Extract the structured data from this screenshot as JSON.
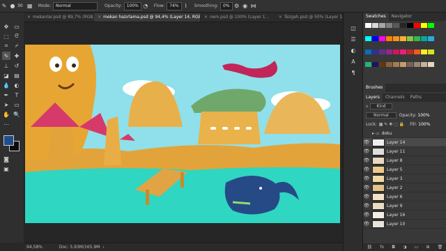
{
  "options_bar": {
    "mode_label": "Mode:",
    "mode_value": "Normal",
    "opacity_label": "Opacity:",
    "opacity_value": "100%",
    "flow_label": "Flow:",
    "flow_value": "74%",
    "smoothing_label": "Smoothing:",
    "smoothing_value": "0%",
    "brush_size": "30"
  },
  "tabs": [
    {
      "label": "mekanlar.psd @ 89,7% (RGB/8) *"
    },
    {
      "label": "mekan hazırlama.psd @ 94,4% (Layer 14, RGB/8) *"
    },
    {
      "label": "nem.psd @ 100% (Layer 1..."
    },
    {
      "label": "Tezgah.psd @ 50% (Layer 1..."
    }
  ],
  "status": {
    "zoom": "94,58%",
    "doc": "Doc: 5,93M/165,9M"
  },
  "panels": {
    "swatches_tab": "Swatches",
    "navigator_tab": "Navigator",
    "brushes_tab": "Brushes",
    "layers_tab": "Layers",
    "channels_tab": "Channels",
    "paths_tab": "Paths",
    "kind": "Kind",
    "blend": "Normal",
    "opacity_label": "Opacity:",
    "opacity_value": "100%",
    "lock_label": "Lock:",
    "fill_label": "Fill:",
    "fill_value": "100%",
    "layers": [
      "doku",
      "Layer 14",
      "Layer 11",
      "Layer 8",
      "Layer 5",
      "Layer 3",
      "Layer 2",
      "Layer 6",
      "Layer 9",
      "Layer 16",
      "Layer 10"
    ]
  },
  "swatch_colors": [
    "#ffffff",
    "#d9d9d9",
    "#a6a6a6",
    "#7f7f7f",
    "#595959",
    "#262626",
    "#000000",
    "#ff0000",
    "#ffff00",
    "#00ff00",
    "#00ffff",
    "#0000ff",
    "#ff00ff",
    "#ff7f00",
    "#f7931e",
    "#fbb03b",
    "#8cc63f",
    "#39b54a",
    "#00a99d",
    "#29abe2",
    "#0071bc",
    "#2e3192",
    "#662d91",
    "#93278f",
    "#d4145a",
    "#ed1e79",
    "#c1272d",
    "#f15a24",
    "#fcee21",
    "#d9e021",
    "#22b573",
    "#1b1464",
    "#603813",
    "#8c6239",
    "#a67c52",
    "#c69c6d",
    "#736357",
    "#998675",
    "#c7b299",
    "#e6d7bd"
  ],
  "colors": {
    "foreground": "#1f4e8c",
    "background": "#0b0b0b"
  }
}
